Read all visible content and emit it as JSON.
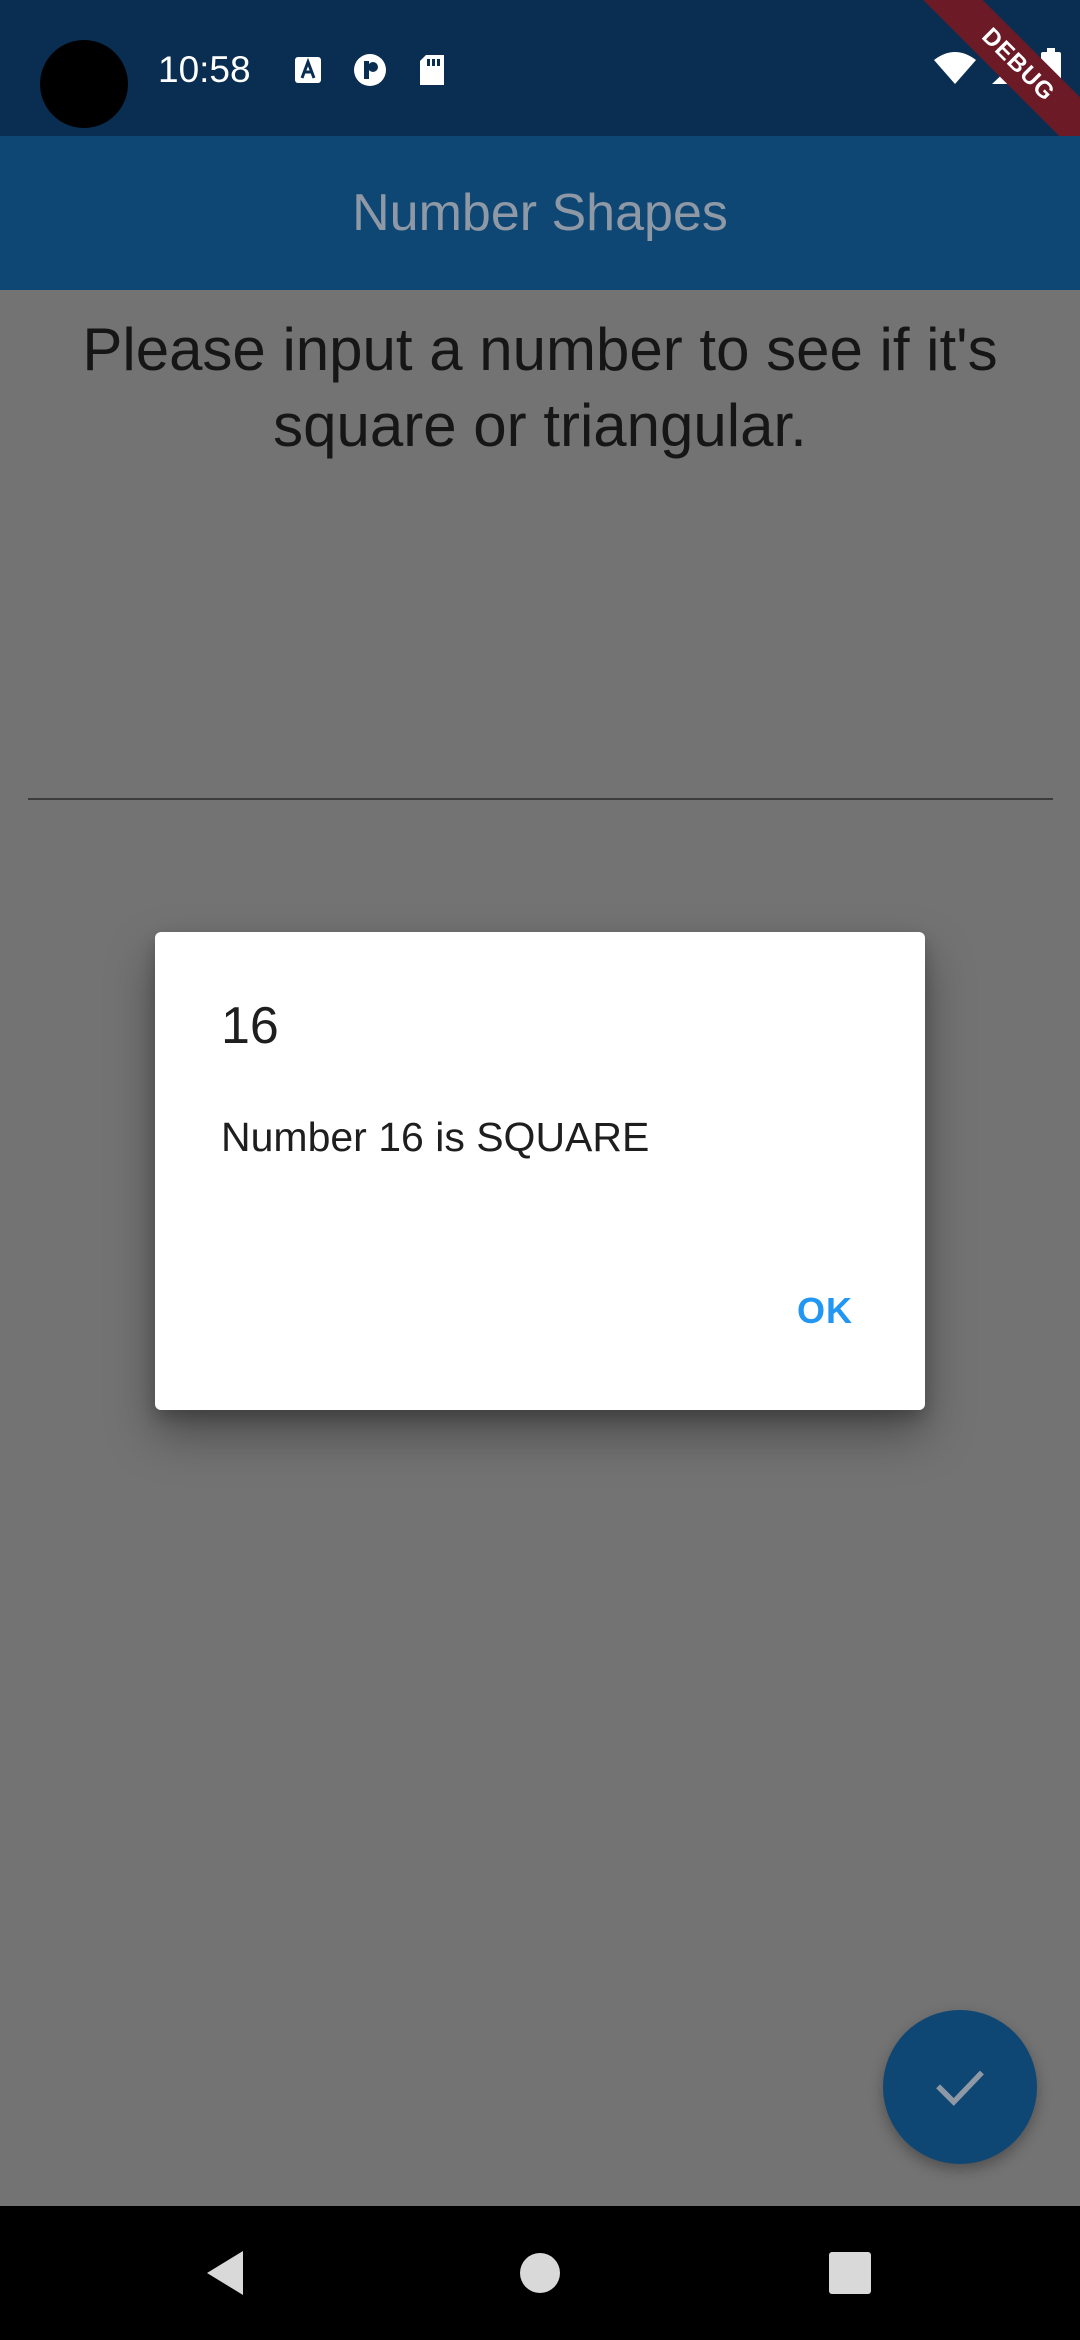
{
  "status_bar": {
    "time": "10:58",
    "notification_icons": [
      "font-a-icon",
      "pinterest-like-icon",
      "sd-card-icon"
    ],
    "system_icons": [
      "wifi-icon",
      "cell-signal-icon",
      "battery-icon"
    ],
    "debug_label": "DEBUG"
  },
  "app_bar": {
    "title": "Number Shapes"
  },
  "main": {
    "prompt": "Please input a number to see if it's square or triangular.",
    "input_value": ""
  },
  "dialog": {
    "title": "16",
    "content": "Number 16 is SQUARE",
    "ok_label": "OK"
  },
  "fab": {
    "icon": "check-icon"
  },
  "nav_bar": {
    "buttons": [
      "back-icon",
      "home-icon",
      "recents-icon"
    ]
  },
  "colors": {
    "status_bar": "#0a2e52",
    "app_bar": "#0e4674",
    "scrim_background": "#737373",
    "accent": "#2196f3",
    "debug_ribbon": "#6b1a26"
  }
}
